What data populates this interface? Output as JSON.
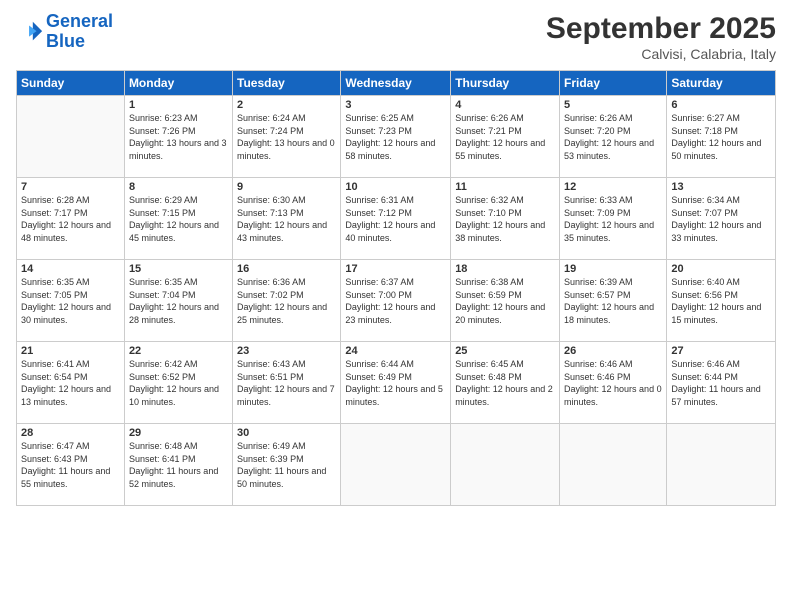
{
  "logo": {
    "line1": "General",
    "line2": "Blue"
  },
  "header": {
    "month": "September 2025",
    "location": "Calvisi, Calabria, Italy"
  },
  "weekdays": [
    "Sunday",
    "Monday",
    "Tuesday",
    "Wednesday",
    "Thursday",
    "Friday",
    "Saturday"
  ],
  "weeks": [
    [
      {
        "day": "",
        "sunrise": "",
        "sunset": "",
        "daylight": ""
      },
      {
        "day": "1",
        "sunrise": "Sunrise: 6:23 AM",
        "sunset": "Sunset: 7:26 PM",
        "daylight": "Daylight: 13 hours and 3 minutes."
      },
      {
        "day": "2",
        "sunrise": "Sunrise: 6:24 AM",
        "sunset": "Sunset: 7:24 PM",
        "daylight": "Daylight: 13 hours and 0 minutes."
      },
      {
        "day": "3",
        "sunrise": "Sunrise: 6:25 AM",
        "sunset": "Sunset: 7:23 PM",
        "daylight": "Daylight: 12 hours and 58 minutes."
      },
      {
        "day": "4",
        "sunrise": "Sunrise: 6:26 AM",
        "sunset": "Sunset: 7:21 PM",
        "daylight": "Daylight: 12 hours and 55 minutes."
      },
      {
        "day": "5",
        "sunrise": "Sunrise: 6:26 AM",
        "sunset": "Sunset: 7:20 PM",
        "daylight": "Daylight: 12 hours and 53 minutes."
      },
      {
        "day": "6",
        "sunrise": "Sunrise: 6:27 AM",
        "sunset": "Sunset: 7:18 PM",
        "daylight": "Daylight: 12 hours and 50 minutes."
      }
    ],
    [
      {
        "day": "7",
        "sunrise": "Sunrise: 6:28 AM",
        "sunset": "Sunset: 7:17 PM",
        "daylight": "Daylight: 12 hours and 48 minutes."
      },
      {
        "day": "8",
        "sunrise": "Sunrise: 6:29 AM",
        "sunset": "Sunset: 7:15 PM",
        "daylight": "Daylight: 12 hours and 45 minutes."
      },
      {
        "day": "9",
        "sunrise": "Sunrise: 6:30 AM",
        "sunset": "Sunset: 7:13 PM",
        "daylight": "Daylight: 12 hours and 43 minutes."
      },
      {
        "day": "10",
        "sunrise": "Sunrise: 6:31 AM",
        "sunset": "Sunset: 7:12 PM",
        "daylight": "Daylight: 12 hours and 40 minutes."
      },
      {
        "day": "11",
        "sunrise": "Sunrise: 6:32 AM",
        "sunset": "Sunset: 7:10 PM",
        "daylight": "Daylight: 12 hours and 38 minutes."
      },
      {
        "day": "12",
        "sunrise": "Sunrise: 6:33 AM",
        "sunset": "Sunset: 7:09 PM",
        "daylight": "Daylight: 12 hours and 35 minutes."
      },
      {
        "day": "13",
        "sunrise": "Sunrise: 6:34 AM",
        "sunset": "Sunset: 7:07 PM",
        "daylight": "Daylight: 12 hours and 33 minutes."
      }
    ],
    [
      {
        "day": "14",
        "sunrise": "Sunrise: 6:35 AM",
        "sunset": "Sunset: 7:05 PM",
        "daylight": "Daylight: 12 hours and 30 minutes."
      },
      {
        "day": "15",
        "sunrise": "Sunrise: 6:35 AM",
        "sunset": "Sunset: 7:04 PM",
        "daylight": "Daylight: 12 hours and 28 minutes."
      },
      {
        "day": "16",
        "sunrise": "Sunrise: 6:36 AM",
        "sunset": "Sunset: 7:02 PM",
        "daylight": "Daylight: 12 hours and 25 minutes."
      },
      {
        "day": "17",
        "sunrise": "Sunrise: 6:37 AM",
        "sunset": "Sunset: 7:00 PM",
        "daylight": "Daylight: 12 hours and 23 minutes."
      },
      {
        "day": "18",
        "sunrise": "Sunrise: 6:38 AM",
        "sunset": "Sunset: 6:59 PM",
        "daylight": "Daylight: 12 hours and 20 minutes."
      },
      {
        "day": "19",
        "sunrise": "Sunrise: 6:39 AM",
        "sunset": "Sunset: 6:57 PM",
        "daylight": "Daylight: 12 hours and 18 minutes."
      },
      {
        "day": "20",
        "sunrise": "Sunrise: 6:40 AM",
        "sunset": "Sunset: 6:56 PM",
        "daylight": "Daylight: 12 hours and 15 minutes."
      }
    ],
    [
      {
        "day": "21",
        "sunrise": "Sunrise: 6:41 AM",
        "sunset": "Sunset: 6:54 PM",
        "daylight": "Daylight: 12 hours and 13 minutes."
      },
      {
        "day": "22",
        "sunrise": "Sunrise: 6:42 AM",
        "sunset": "Sunset: 6:52 PM",
        "daylight": "Daylight: 12 hours and 10 minutes."
      },
      {
        "day": "23",
        "sunrise": "Sunrise: 6:43 AM",
        "sunset": "Sunset: 6:51 PM",
        "daylight": "Daylight: 12 hours and 7 minutes."
      },
      {
        "day": "24",
        "sunrise": "Sunrise: 6:44 AM",
        "sunset": "Sunset: 6:49 PM",
        "daylight": "Daylight: 12 hours and 5 minutes."
      },
      {
        "day": "25",
        "sunrise": "Sunrise: 6:45 AM",
        "sunset": "Sunset: 6:48 PM",
        "daylight": "Daylight: 12 hours and 2 minutes."
      },
      {
        "day": "26",
        "sunrise": "Sunrise: 6:46 AM",
        "sunset": "Sunset: 6:46 PM",
        "daylight": "Daylight: 12 hours and 0 minutes."
      },
      {
        "day": "27",
        "sunrise": "Sunrise: 6:46 AM",
        "sunset": "Sunset: 6:44 PM",
        "daylight": "Daylight: 11 hours and 57 minutes."
      }
    ],
    [
      {
        "day": "28",
        "sunrise": "Sunrise: 6:47 AM",
        "sunset": "Sunset: 6:43 PM",
        "daylight": "Daylight: 11 hours and 55 minutes."
      },
      {
        "day": "29",
        "sunrise": "Sunrise: 6:48 AM",
        "sunset": "Sunset: 6:41 PM",
        "daylight": "Daylight: 11 hours and 52 minutes."
      },
      {
        "day": "30",
        "sunrise": "Sunrise: 6:49 AM",
        "sunset": "Sunset: 6:39 PM",
        "daylight": "Daylight: 11 hours and 50 minutes."
      },
      {
        "day": "",
        "sunrise": "",
        "sunset": "",
        "daylight": ""
      },
      {
        "day": "",
        "sunrise": "",
        "sunset": "",
        "daylight": ""
      },
      {
        "day": "",
        "sunrise": "",
        "sunset": "",
        "daylight": ""
      },
      {
        "day": "",
        "sunrise": "",
        "sunset": "",
        "daylight": ""
      }
    ]
  ]
}
